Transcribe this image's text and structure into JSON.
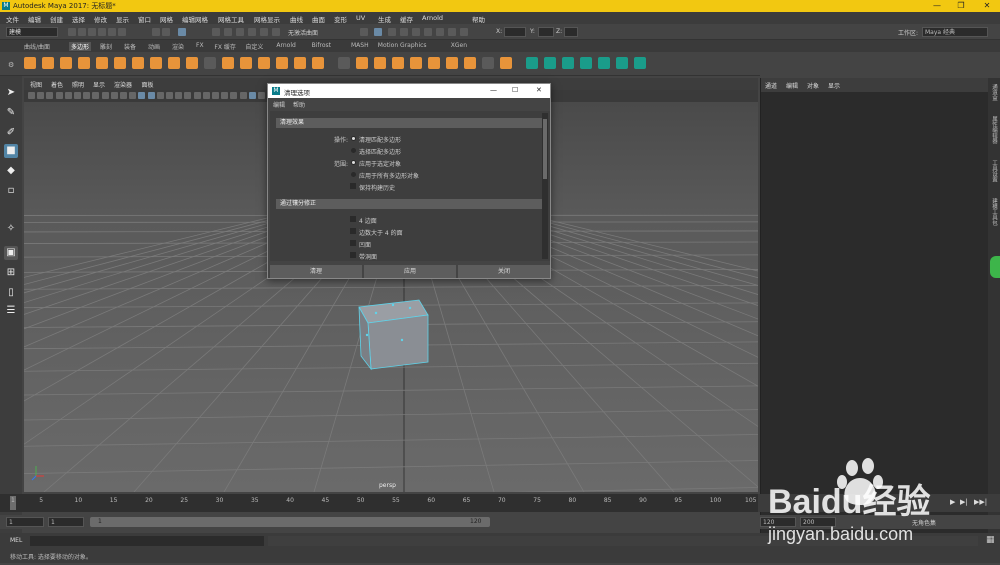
{
  "window": {
    "title": "Autodesk Maya 2017: 无标题*",
    "min": "—",
    "max": "❐",
    "close": "✕"
  },
  "menubar": [
    "文件",
    "编辑",
    "创建",
    "选择",
    "修改",
    "显示",
    "窗口",
    "网格",
    "编辑网格",
    "网格工具",
    "网格显示",
    "曲线",
    "曲面",
    "变形",
    "UV",
    "生成",
    "缓存",
    "Arnold",
    "帮助"
  ],
  "status": {
    "mode": "建模",
    "live_surface": "无激活曲面",
    "x_label": "X:",
    "y_label": "Y:",
    "z_label": "Z:",
    "workspace_label": "工作区:",
    "workspace_value": "Maya 经典"
  },
  "shelf_tabs": [
    "曲线/曲面",
    "多边形",
    "雕刻",
    "装备",
    "动画",
    "渲染",
    "FX",
    "FX 缓存",
    "自定义",
    "Arnold",
    "Bifrost",
    "MASH",
    "Motion Graphics",
    "XGen"
  ],
  "shelf_active": "多边形",
  "panel_menu": [
    "视图",
    "着色",
    "照明",
    "显示",
    "渲染器",
    "面板"
  ],
  "viewport": {
    "camera_label": "persp"
  },
  "right_panel": {
    "menu": [
      "通道",
      "编辑",
      "对象",
      "显示"
    ]
  },
  "side_tabs": [
    "通道盒",
    "属性编辑器",
    "工具设置",
    "建模工具包"
  ],
  "dialog": {
    "title": "清理选项",
    "menu": [
      "编辑",
      "帮助"
    ],
    "section1": "清理效果",
    "op_label": "操作:",
    "op_options": [
      "清理匹配多边形",
      "选择匹配多边形"
    ],
    "scope_label": "范围:",
    "scope_options": [
      "应用于选定对象",
      "应用于所有多边形对象"
    ],
    "keep_history": "保持构建历史",
    "section2": "通过镶分修正",
    "fix_options": [
      "4 边面",
      "边数大于 4 的面",
      "凹面",
      "带洞面"
    ],
    "buttons": {
      "cleanup": "清理",
      "apply": "应用",
      "close": "关闭"
    }
  },
  "timeline": {
    "ticks": [
      1,
      5,
      10,
      15,
      20,
      25,
      30,
      35,
      40,
      45,
      50,
      55,
      60,
      65,
      70,
      75,
      80,
      85,
      90,
      95,
      100,
      105
    ],
    "current": 1
  },
  "range": {
    "start": "1",
    "start2": "1",
    "slider_start": "1",
    "slider_end": "120",
    "end": "120",
    "end2": "200",
    "char_set": "无角色集"
  },
  "mel": {
    "label": "MEL"
  },
  "help_text": "移动工具: 选择要移动的对象。",
  "watermark": {
    "brand": "Baidu经验",
    "url": "jingyan.baidu.com"
  }
}
